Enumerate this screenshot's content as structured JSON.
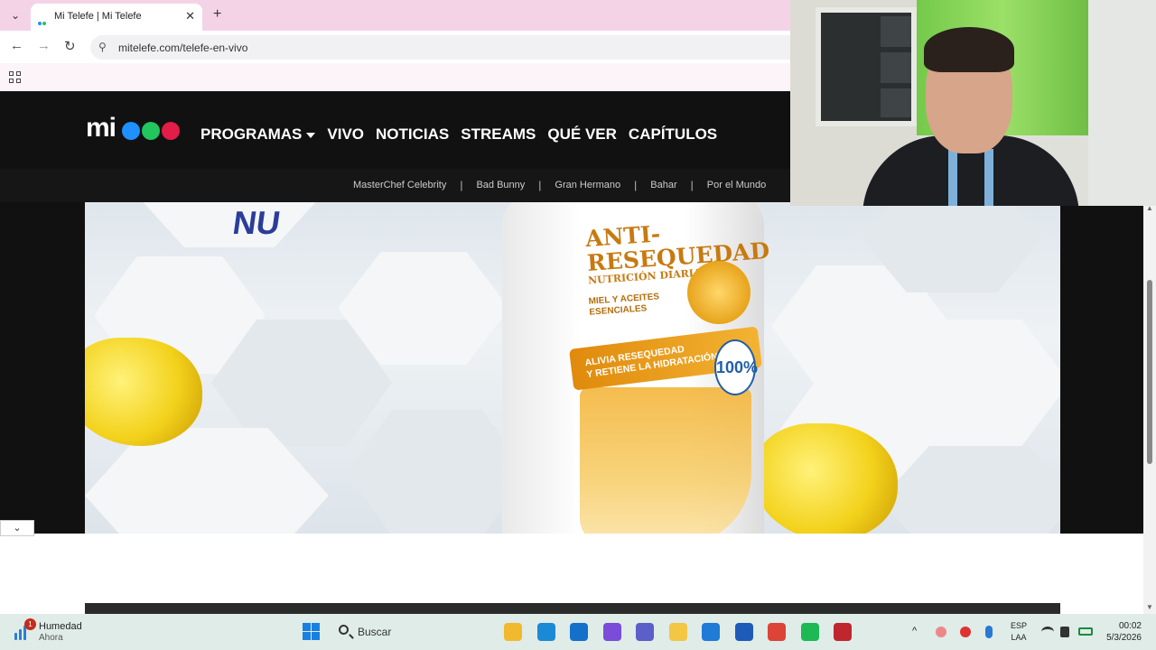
{
  "browser": {
    "tab_title": "Mi Telefe | Mi Telefe",
    "close_glyph": "✕",
    "new_tab_glyph": "+",
    "url": "mitelefe.com/telefe-en-vivo",
    "back_glyph": "←",
    "forward_glyph": "→",
    "reload_glyph": "↻",
    "site_info_glyph": "⚲",
    "tab_dropdown_glyph": "⌄"
  },
  "site": {
    "logo_text": "mi",
    "logo_dots": [
      "#1e90ff",
      "#22c55e",
      "#e11d48"
    ],
    "nav": [
      {
        "label": "PROGRAMAS",
        "dropdown": true
      },
      {
        "label": "VIVO"
      },
      {
        "label": "NOTICIAS"
      },
      {
        "label": "STREAMS"
      },
      {
        "label": "QUÉ VER"
      },
      {
        "label": "CAPÍTULOS"
      }
    ],
    "subnav": [
      "MasterChef Celebrity",
      "Bad Bunny",
      "Gran Hermano",
      "Bahar",
      "Por el Mundo"
    ],
    "subnav_separator": "|"
  },
  "video": {
    "corner_text": "NU",
    "bottle_title_line1": "ANTI-",
    "bottle_title_line2": "RESEQUEDAD",
    "bottle_subtitle": "NUTRICIÓN DIARIA",
    "bottle_small_line1": "MIEL Y ACEITES",
    "bottle_small_line2": "ESENCIALES",
    "band_line1": "ALIVIA RESEQUEDAD",
    "band_line2": "Y RETIENE LA HIDRATACIÓN",
    "seal_text": "100%"
  },
  "page": {
    "collapse_glyph": "⌄"
  },
  "taskbar": {
    "weather_title": "Humedad",
    "weather_sub": "Ahora",
    "weather_badge": "1",
    "search_label": "Buscar",
    "tray_caret": "^",
    "lang_line1": "ESP",
    "lang_line2": "LAA",
    "time": "00:02",
    "date": "5/3/2026",
    "apps": [
      {
        "name": "file-explorer-icon",
        "color": "#f2b92f"
      },
      {
        "name": "edge-icon",
        "color": "#1b8ad6"
      },
      {
        "name": "mail-icon",
        "color": "#1570c9"
      },
      {
        "name": "copilot-icon",
        "color": "#7a4cd9"
      },
      {
        "name": "teams-icon",
        "color": "#5b5fc7"
      },
      {
        "name": "folder-icon",
        "color": "#f3c644"
      },
      {
        "name": "store-icon",
        "color": "#1f7bd6"
      },
      {
        "name": "word-icon",
        "color": "#1e5bb8"
      },
      {
        "name": "chrome-icon",
        "color": "#db4437"
      },
      {
        "name": "spotify-icon",
        "color": "#1db954"
      },
      {
        "name": "record-icon",
        "color": "#c0262d"
      }
    ]
  }
}
